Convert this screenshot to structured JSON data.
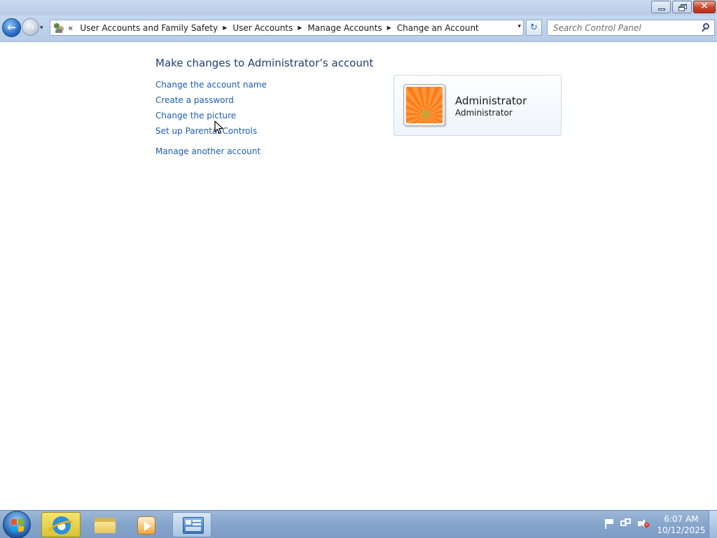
{
  "window": {
    "controls": {
      "minimize_icon": "minimize-icon",
      "restore_icon": "restore-icon",
      "close_glyph": "✕"
    }
  },
  "navigation": {
    "back_glyph": "←",
    "forward_glyph": "→",
    "history_glyph": "▾",
    "address_icon": "user-accounts-icon",
    "overflow_glyph": "«",
    "separator_glyph": "▶",
    "breadcrumbs": [
      "User Accounts and Family Safety",
      "User Accounts",
      "Manage Accounts",
      "Change an Account"
    ],
    "dropdown_glyph": "▾",
    "refresh_glyph": "↻",
    "search_placeholder": "Search Control Panel",
    "search_icon": "search-icon"
  },
  "main": {
    "title": "Make changes to Administrator’s account",
    "tasks": [
      "Change the account name",
      "Create a password",
      "Change the picture",
      "Set up Parental Controls"
    ],
    "secondary_task": "Manage another account",
    "account": {
      "name": "Administrator",
      "type": "Administrator",
      "picture_icon": "flower-picture-icon"
    }
  },
  "taskbar": {
    "start_icon": "windows-start-icon",
    "pinned": [
      "internet-explorer-icon",
      "folder-icon",
      "media-player-icon",
      "control-panel-icon"
    ],
    "tray_icons": [
      "action-center-flag-icon",
      "network-icon",
      "volume-muted-icon"
    ],
    "mute_glyph": "×",
    "clock": {
      "time": "6:07 AM",
      "date": "10/12/2025"
    }
  },
  "colors": {
    "link": "#1a5fb4",
    "title": "#1e3f73",
    "taskbar": "#86a5cc",
    "navbar": "#c6d8ef"
  }
}
